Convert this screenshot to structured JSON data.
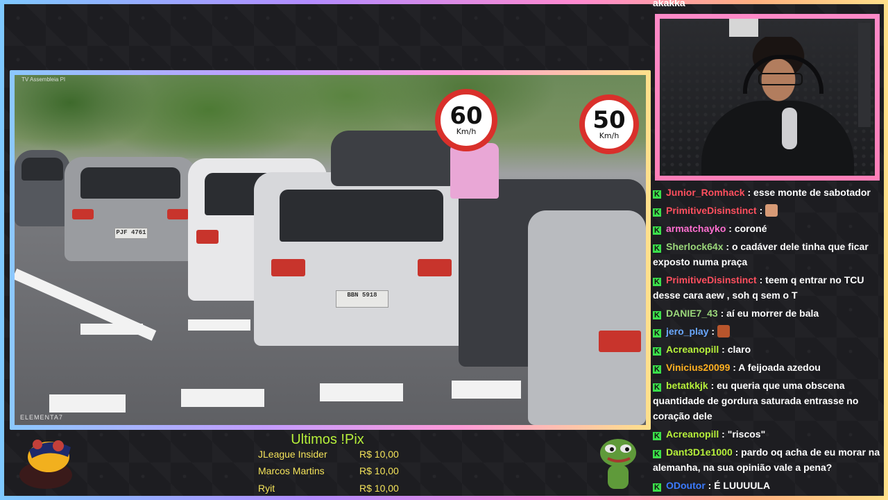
{
  "stream": {
    "colors": {
      "frame_gradient": [
        "#7ec8ff",
        "#b38cff",
        "#ff8ad0",
        "#ffe08a"
      ],
      "pix_title": "#b6f03a",
      "pix_text": "#f4e35a",
      "chat_badge": "#3be04a"
    }
  },
  "video": {
    "watermark_top": "TV Assembleia PI",
    "watermark_bottom": "ELEMENTA7",
    "sign_60": {
      "num": "60",
      "unit": "Km/h"
    },
    "sign_50": {
      "num": "50",
      "unit": "Km/h"
    },
    "plate_main": "BBN 5918",
    "plate_left": "PJF 4761"
  },
  "chat": {
    "partial_top": "akakka",
    "messages": [
      {
        "user": "Junior_Romhack",
        "color": "#ff4f5e",
        "text": " : esse monte de sabotador"
      },
      {
        "user": "PrimitiveDisinstinct",
        "color": "#ff4f5e",
        "text": " : ",
        "emote": "hand-emote"
      },
      {
        "user": "armatchayko",
        "color": "#ff6fd0",
        "text": " : coroné"
      },
      {
        "user": "Sherlock64x",
        "color": "#9ad67a",
        "text": " : o cadáver dele tinha que ficar exposto numa praça"
      },
      {
        "user": "PrimitiveDisinstinct",
        "color": "#ff4f5e",
        "text": " : teem q entrar no TCU desse cara aew , soh q sem o T"
      },
      {
        "user": "DANIE7_43",
        "color": "#9ad67a",
        "text": " : aí eu morrer de bala"
      },
      {
        "user": "jero_play",
        "color": "#6aa8ff",
        "text": " : ",
        "emote": "face-emote"
      },
      {
        "user": "Acreanopill",
        "color": "#b6f03a",
        "text": " : claro"
      },
      {
        "user": "Vinicius20099",
        "color": "#ffb020",
        "text": " : A feijoada azedou"
      },
      {
        "user": "betatkkjk",
        "color": "#b6f03a",
        "text": " : eu queria que uma obscena quantidade de gordura saturada entrasse no coração dele"
      },
      {
        "user": "Acreanopill",
        "color": "#b6f03a",
        "text": " : \"riscos\""
      },
      {
        "user": "Dant3D1e1000",
        "color": "#b6f03a",
        "text": " : pardo oq acha de eu morar na alemanha, na sua opinião vale a pena?"
      },
      {
        "user": "ODoutor",
        "color": "#3b7bff",
        "text": " : É LUUUULA"
      }
    ]
  },
  "pix": {
    "title": "Ultimos !Pix",
    "donations": [
      {
        "name": "JLeague Insider",
        "amount": "R$ 10,00"
      },
      {
        "name": "Marcos Martins",
        "amount": "R$ 10,00"
      },
      {
        "name": "Ryit",
        "amount": "R$ 10,00"
      }
    ]
  }
}
